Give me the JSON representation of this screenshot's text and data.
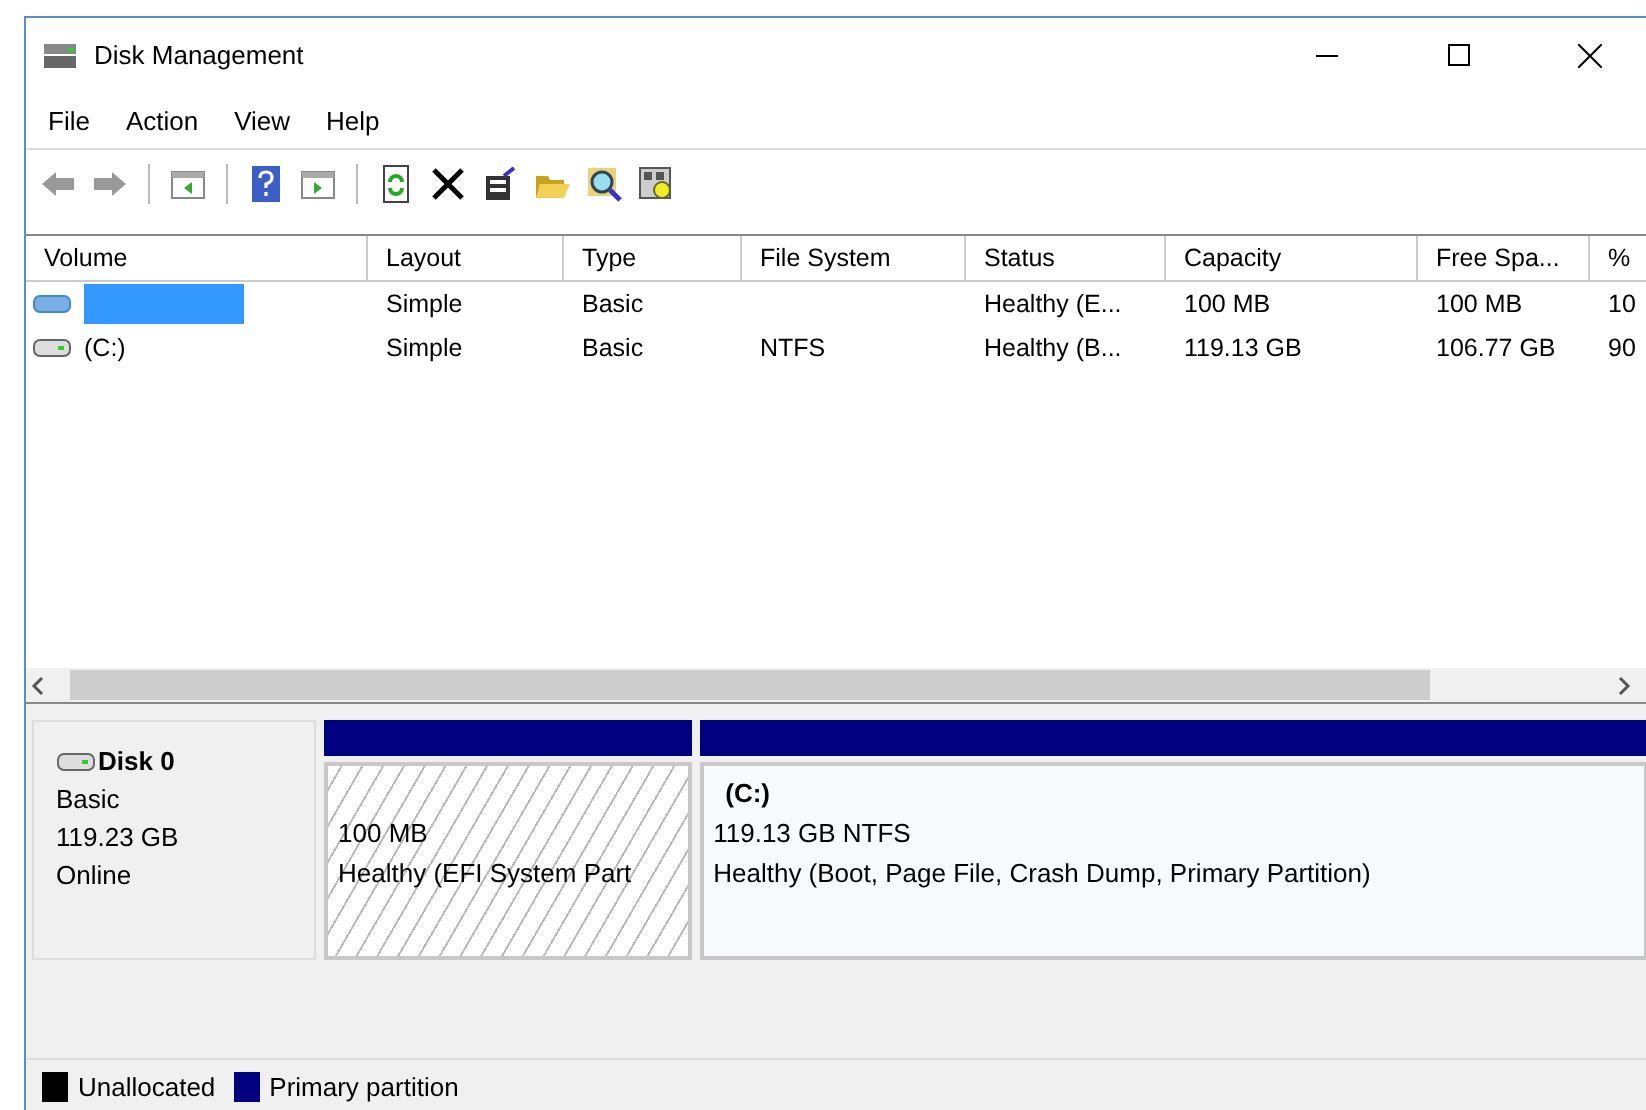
{
  "window": {
    "title": "Disk Management"
  },
  "menu": [
    "File",
    "Action",
    "View",
    "Help"
  ],
  "table": {
    "columns": [
      "Volume",
      "Layout",
      "Type",
      "File System",
      "Status",
      "Capacity",
      "Free Spa...",
      "%"
    ],
    "rows": [
      {
        "kind": "efi",
        "selected": true,
        "cells": [
          "",
          "Simple",
          "Basic",
          "",
          "Healthy (E...",
          "100 MB",
          "100 MB",
          "10"
        ]
      },
      {
        "kind": "drive",
        "selected": false,
        "cells": [
          "(C:)",
          "Simple",
          "Basic",
          "NTFS",
          "Healthy (B...",
          "119.13 GB",
          "106.77 GB",
          "90"
        ]
      }
    ]
  },
  "disk": {
    "name": "Disk 0",
    "type": "Basic",
    "size": "119.23 GB",
    "state": "Online",
    "partitions": [
      {
        "kind": "system",
        "size": "100 MB",
        "status": "Healthy (EFI System Part",
        "color": "#000080"
      },
      {
        "kind": "primary",
        "label": "(C:)",
        "size": "119.13 GB NTFS",
        "status": "Healthy (Boot, Page File, Crash Dump, Primary Partition)",
        "color": "#000080"
      }
    ]
  },
  "legend": [
    {
      "label": "Unallocated",
      "color": "#000000"
    },
    {
      "label": "Primary partition",
      "color": "#000080"
    }
  ]
}
